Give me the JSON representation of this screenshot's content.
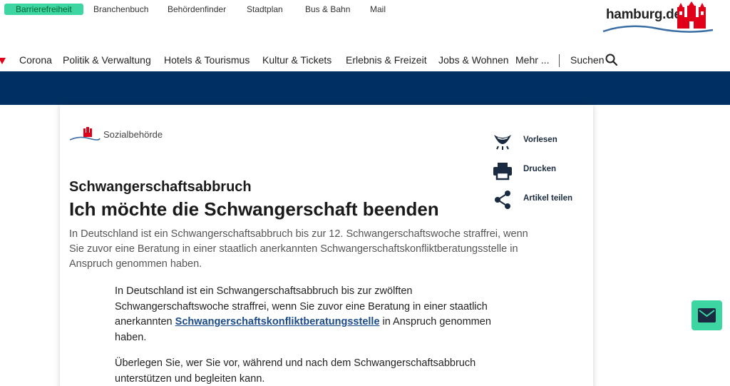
{
  "topbar": {
    "links": [
      "Barrierefreiheit",
      "Branchenbuch",
      "Behördenfinder",
      "Stadtplan",
      "Bus & Bahn",
      "Mail"
    ]
  },
  "logo": {
    "text": "hamburg.de"
  },
  "nav": {
    "items": [
      "Corona",
      "Politik & Verwaltung",
      "Hotels & Tourismus",
      "Kultur & Tickets",
      "Erlebnis & Freizeit",
      "Jobs & Wohnen",
      "Mehr ..."
    ],
    "search_label": "Suchen"
  },
  "article": {
    "department": "Sozialbehörde",
    "kicker": "Schwangerschaftsabbruch",
    "headline": "Ich möchte die Schwangerschaft beenden",
    "lead": "In Deutschland ist ein Schwangerschaftsabbruch bis zur 12. Schwangerschaftswoche straffrei, wenn Sie zuvor eine Beratung in einer staatlich anerkannten Schwangerschaftskonfliktberatungsstelle in Anspruch genommen haben.",
    "p1_before": "In Deutschland ist ein Schwangerschaftsabbruch bis zur zwölften Schwangerschaftswoche straffrei, wenn Sie zuvor eine Beratung in einer staatlich anerkannten ",
    "p1_link": "Schwangerschaftskonfliktberatungsstelle",
    "p1_after": " in Anspruch genommen haben.",
    "p2": "Überlegen Sie, wer Sie vor, während und nach dem Schwangerschaftsabbruch unterstützen und begleiten kann."
  },
  "tools": {
    "read_aloud": "Vorlesen",
    "print": "Drucken",
    "share": "Artikel teilen"
  },
  "colors": {
    "accent_green": "#3dd6a3",
    "navy_band": "#003063",
    "brand_red": "#e10019",
    "link_blue": "#1a4a8a"
  },
  "icons": [
    "search-icon",
    "speaker-icon",
    "printer-icon",
    "share-icon",
    "mail-icon",
    "hamburg-castle-icon"
  ]
}
